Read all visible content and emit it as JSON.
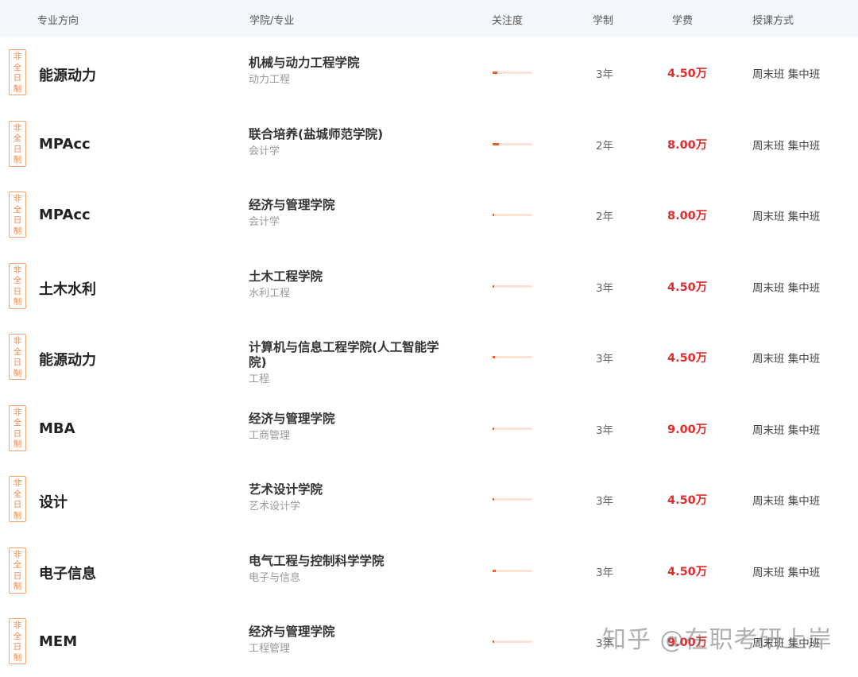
{
  "header": {
    "direction": "专业方向",
    "college": "学院/专业",
    "attention": "关注度",
    "duration": "学制",
    "fee": "学费",
    "mode": "授课方式"
  },
  "rows": [
    {
      "tag": [
        "非",
        "全",
        "日",
        "制"
      ],
      "direction": "能源动力",
      "college": "机械与动力工程学院",
      "major": "动力工程",
      "attention": 0.12,
      "duration": "3年",
      "fee": "4.50万",
      "mode": "周末班 集中班"
    },
    {
      "tag": [
        "非",
        "全",
        "日",
        "制"
      ],
      "direction": "MPAcc",
      "college": "联合培养(盐城师范学院)",
      "major": "会计学",
      "attention": 0.16,
      "duration": "2年",
      "fee": "8.00万",
      "mode": "周末班 集中班"
    },
    {
      "tag": [
        "非",
        "全",
        "日",
        "制"
      ],
      "direction": "MPAcc",
      "college": "经济与管理学院",
      "major": "会计学",
      "attention": 0.03,
      "duration": "2年",
      "fee": "8.00万",
      "mode": "周末班 集中班"
    },
    {
      "tag": [
        "非",
        "全",
        "日",
        "制"
      ],
      "direction": "土木水利",
      "college": "土木工程学院",
      "major": "水利工程",
      "attention": 0.04,
      "duration": "3年",
      "fee": "4.50万",
      "mode": "周末班 集中班"
    },
    {
      "tag": [
        "非",
        "全",
        "日",
        "制"
      ],
      "direction": "能源动力",
      "college": "计算机与信息工程学院(人工智能学院)",
      "major": "工程",
      "attention": 0.05,
      "duration": "3年",
      "fee": "4.50万",
      "mode": "周末班 集中班"
    },
    {
      "tag": [
        "非",
        "全",
        "日",
        "制"
      ],
      "direction": "MBA",
      "college": "经济与管理学院",
      "major": "工商管理",
      "attention": 0.04,
      "duration": "3年",
      "fee": "9.00万",
      "mode": "周末班 集中班"
    },
    {
      "tag": [
        "非",
        "全",
        "日",
        "制"
      ],
      "direction": "设计",
      "college": "艺术设计学院",
      "major": "艺术设计学",
      "attention": 0.04,
      "duration": "3年",
      "fee": "4.50万",
      "mode": "周末班 集中班"
    },
    {
      "tag": [
        "非",
        "全",
        "日",
        "制"
      ],
      "direction": "电子信息",
      "college": "电气工程与控制科学学院",
      "major": "电子与信息",
      "attention": 0.08,
      "duration": "3年",
      "fee": "4.50万",
      "mode": "周末班 集中班"
    },
    {
      "tag": [
        "非",
        "全",
        "日",
        "制"
      ],
      "direction": "MEM",
      "college": "经济与管理学院",
      "major": "工程管理",
      "attention": 0.03,
      "duration": "3年",
      "fee": "9.00万",
      "mode": "周末班 集中班"
    }
  ],
  "watermark": "知乎 @在职考研上岸",
  "colors": {
    "accent_orange": "#ef5a1f",
    "fee_red": "#e02d2d",
    "tag_orange": "#f08a4b"
  }
}
